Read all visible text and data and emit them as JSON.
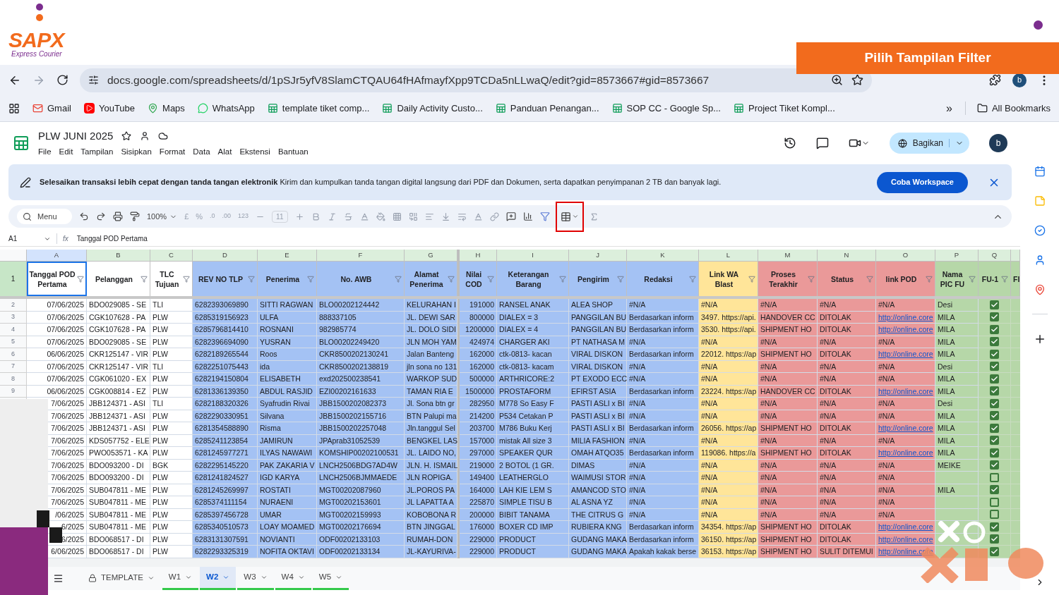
{
  "slide": {
    "logo": {
      "name": "SAPX",
      "tagline": "Express Courier"
    },
    "callout": "Pilih Tampilan Filter"
  },
  "browser": {
    "url": "docs.google.com/spreadsheets/d/1pSJr5yfV8SlamCTQAU64fHAfmayfXpp9TCDa5nLLwaQ/edit?gid=8573667#gid=8573667",
    "profile": "b",
    "bookmarks": [
      {
        "label": "Gmail",
        "kind": "mail"
      },
      {
        "label": "YouTube",
        "kind": "video"
      },
      {
        "label": "Maps",
        "kind": "map"
      },
      {
        "label": "WhatsApp",
        "kind": "chat"
      },
      {
        "label": "template tiket comp...",
        "kind": "sheet"
      },
      {
        "label": "Daily Activity Custo...",
        "kind": "sheet"
      },
      {
        "label": "Panduan Penangan...",
        "kind": "sheet"
      },
      {
        "label": "SOP CC - Google Sp...",
        "kind": "sheet"
      },
      {
        "label": "Project Tiket Kompl...",
        "kind": "sheet"
      }
    ],
    "more": "»",
    "all_bookmarks": "All Bookmarks"
  },
  "doc": {
    "title": "PLW JUNI 2025",
    "menus": [
      "File",
      "Edit",
      "Tampilan",
      "Sisipkan",
      "Format",
      "Data",
      "Alat",
      "Ekstensi",
      "Bantuan"
    ],
    "share": "Bagikan",
    "avatar": "b"
  },
  "promo": {
    "lead": "Selesaikan transaksi lebih cepat dengan tanda tangan elektronik",
    "text": "Kirim dan kumpulkan tanda tangan digital langsung dari PDF dan Dokumen, serta dapatkan penyimpanan 2 TB dan banyak lagi.",
    "button": "Coba Workspace"
  },
  "toolbar": {
    "search": "Menu",
    "zoom": "100%",
    "currency": "£",
    "percent": "%",
    "dec_less": ".0",
    "dec_more": ".00",
    "number_format": "123",
    "font_size": "11",
    "filter_view_highlighted": true
  },
  "formula_bar": {
    "cell": "A1",
    "fx": "fx",
    "value": "Tanggal POD Pertama"
  },
  "columns": [
    {
      "letter": "A",
      "label": "Tanggal POD Pertama",
      "color": "#ffffff"
    },
    {
      "letter": "B",
      "label": "Pelanggan",
      "color": "#ffffff"
    },
    {
      "letter": "C",
      "label": "TLC Tujuan",
      "color": "#ffffff"
    },
    {
      "letter": "D",
      "label": "REV NO TLP",
      "color": "#a4c2f4"
    },
    {
      "letter": "E",
      "label": "Penerima",
      "color": "#a4c2f4"
    },
    {
      "letter": "F",
      "label": "No. AWB",
      "color": "#a4c2f4"
    },
    {
      "letter": "G",
      "label": "Alamat Penerima",
      "color": "#a4c2f4"
    },
    {
      "letter": "H",
      "label": "Nilai COD",
      "color": "#a4c2f4"
    },
    {
      "letter": "I",
      "label": "Keterangan Barang",
      "color": "#a4c2f4"
    },
    {
      "letter": "J",
      "label": "Pengirim",
      "color": "#a4c2f4"
    },
    {
      "letter": "K",
      "label": "Redaksi",
      "color": "#a4c2f4"
    },
    {
      "letter": "L",
      "label": "Link WA Blast",
      "color": "#ffe599"
    },
    {
      "letter": "M",
      "label": "Proses Terakhir",
      "color": "#ea9999"
    },
    {
      "letter": "N",
      "label": "Status",
      "color": "#ea9999"
    },
    {
      "letter": "O",
      "label": "link POD",
      "color": "#ea9999"
    },
    {
      "letter": "P",
      "label": "Nama PIC FU",
      "color": "#b6d7a8"
    },
    {
      "letter": "Q",
      "label": "FU-1",
      "color": "#b6d7a8"
    },
    {
      "label": "FI",
      "color": "#b6d7a8"
    }
  ],
  "header_row_number": "1",
  "rows": [
    {
      "num": "2",
      "cells": [
        "07/06/2025",
        "BDO029085 - SE",
        "TLI",
        "6282393069890",
        "SITTI RAGWAN",
        "BLO00202124442",
        "KELURAHAN I",
        "191000",
        "RANSEL ANAK",
        "ALEA SHOP",
        "#N/A",
        "#N/A",
        "#N/A",
        "#N/A",
        "#N/A",
        "Desi"
      ],
      "pod_linked": false,
      "fu1": true
    },
    {
      "num": "3",
      "cells": [
        "07/06/2025",
        "CGK107628 - PA",
        "PLW",
        "6285319156923",
        "ULFA",
        "888337105",
        "JL. DEWI SAR",
        "800000",
        "DIALEX = 3",
        "PANGGILAN BU",
        "Berdasarkan inform",
        "3497. https://api.",
        "HANDOVER CC",
        "DITOLAK",
        "http://online.core",
        "MILA"
      ],
      "pod_linked": true,
      "fu1": true
    },
    {
      "num": "4",
      "cells": [
        "07/06/2025",
        "CGK107628 - PA",
        "PLW",
        "6285796814410",
        "ROSNANI",
        "982985774",
        "JL. DOLO SIDI",
        "1200000",
        "DIALEX = 4",
        "PANGGILAN BU",
        "Berdasarkan inform",
        "3530. https://api.",
        "SHIPMENT HO",
        "DITOLAK",
        "http://online.core",
        "MILA"
      ],
      "pod_linked": true,
      "fu1": true
    },
    {
      "num": "5",
      "cells": [
        "07/06/2025",
        "BDO029085 - SE",
        "PLW",
        "6282396694090",
        "YUSRAN",
        "BLO00202249420",
        "JLN MOH YAM",
        "424974",
        "CHARGER AKI",
        "PT NATHASA M",
        "#N/A",
        "#N/A",
        "#N/A",
        "#N/A",
        "#N/A",
        "MILA"
      ],
      "pod_linked": false,
      "fu1": true
    },
    {
      "num": "6",
      "cells": [
        "06/06/2025",
        "CKR125147 - VIR",
        "PLW",
        "6282189265544",
        "Roos",
        "CKR8500202130241",
        "Jalan Banteng",
        "162000",
        "ctk-0813-  kacan",
        "VIRAL DISKON",
        "Berdasarkan inform",
        "22012. https://ap",
        "SHIPMENT HO",
        "DITOLAK",
        "http://online.core",
        "MILA"
      ],
      "pod_linked": true,
      "fu1": true
    },
    {
      "num": "7",
      "cells": [
        "07/06/2025",
        "CKR125147 - VIR",
        "TLI",
        "6282251075443",
        "ida",
        "CKR8500202138819",
        "jln sona no 131",
        "162000",
        "ctk-0813- kacam",
        "VIRAL DISKON",
        "#N/A",
        "#N/A",
        "#N/A",
        "#N/A",
        "#N/A",
        "Desi"
      ],
      "pod_linked": false,
      "fu1": true
    },
    {
      "num": "8",
      "cells": [
        "07/06/2025",
        "CGK061020 - EX",
        "PLW",
        "6282194150804",
        "ELISABETH",
        "exd202500238541",
        "WARKOP SUD",
        "500000",
        "ARTHRICORE:2",
        "PT EXODO ECC",
        "#N/A",
        "#N/A",
        "#N/A",
        "#N/A",
        "#N/A",
        "MILA"
      ],
      "pod_linked": false,
      "fu1": true
    },
    {
      "num": "9",
      "cells": [
        "06/06/2025",
        "CGK008814 - EZ",
        "PLW",
        "6281336139350",
        "ABDUL RASJID",
        "EZI00202161633",
        "TAMAN RIA E",
        "1500000",
        "PROSTAFORM",
        "EFIRST ASIA",
        "Berdasarkan inform",
        "23224. https://ap",
        "HANDOVER CC",
        "DITOLAK",
        "http://online.core",
        "MILA"
      ],
      "pod_linked": true,
      "fu1": true
    },
    {
      "cells": [
        "7/06/2025",
        "JBB124371 - ASI",
        "TLI",
        "6282188320326",
        "Syafrudin Rivai",
        "JBB1500202082373",
        "Jl. Sona btn gr",
        "282950",
        "M778 So Easy F",
        "PASTI ASLI x BI",
        "#N/A",
        "#N/A",
        "#N/A",
        "#N/A",
        "#N/A",
        "Desi"
      ],
      "pod_linked": false,
      "fu1": true
    },
    {
      "cells": [
        "7/06/2025",
        "JBB124371 - ASI",
        "PLW",
        "6282290330951",
        "Silvana",
        "JBB1500202155716",
        "BTN Palupi ma",
        "214200",
        "P534 Cetakan P",
        "PASTI ASLI x BI",
        "#N/A",
        "#N/A",
        "#N/A",
        "#N/A",
        "#N/A",
        "MILA"
      ],
      "pod_linked": false,
      "fu1": true
    },
    {
      "cells": [
        "7/06/2025",
        "JBB124371 - ASI",
        "PLW",
        "6281354588890",
        "Risma",
        "JBB1500202257048",
        "Jln.tanggul Sel",
        "203700",
        "M786 Buku Kerj",
        "PASTI ASLI x BI",
        "Berdasarkan inform",
        "26056. https://ap",
        "SHIPMENT HO",
        "DITOLAK",
        "http://online.core",
        "MILA"
      ],
      "pod_linked": true,
      "fu1": true
    },
    {
      "cells": [
        "7/06/2025",
        "KDS057752 - ELE",
        "PLW",
        "6285241123854",
        "JAMIRUN",
        "JPAprab31052539",
        "BENGKEL LAS",
        "157000",
        "mistak All size 3",
        "MILIA FASHION",
        "#N/A",
        "#N/A",
        "#N/A",
        "#N/A",
        "#N/A",
        "MILA"
      ],
      "pod_linked": false,
      "fu1": true
    },
    {
      "cells": [
        "7/06/2025",
        "PWO053571 - KA",
        "PLW",
        "6281245977271",
        "ILYAS NAWAWI",
        "KOMSHIP00202100531",
        "JL. LAIDO NO,",
        "297000",
        "SPEAKER QUR",
        "OMAH ATQO35",
        "Berdasarkan inform",
        "119086. https://a",
        "SHIPMENT HO",
        "DITOLAK",
        "http://online.core",
        "MILA"
      ],
      "pod_linked": true,
      "fu1": true
    },
    {
      "cells": [
        "7/06/2025",
        "BDO093200 - DI",
        "BGK",
        "6282295145220",
        "PAK ZAKARIA V",
        "LNCH2506BDG7AD4W",
        "JLN. H. ISMAIL",
        "219000",
        "2 BOTOL (1 GR.",
        "DIMAS",
        "#N/A",
        "#N/A",
        "#N/A",
        "#N/A",
        "#N/A",
        "MEIKE"
      ],
      "pod_linked": false,
      "fu1": true
    },
    {
      "cells": [
        "7/06/2025",
        "BDO093200 - DI",
        "PLW",
        "6281241824527",
        "IGD KARYA",
        "LNCH2506BJMMAEDE",
        "JLN ROPIGA.",
        "149400",
        "LEATHERGLO",
        "WAIMUSI STOR",
        "#N/A",
        "#N/A",
        "#N/A",
        "#N/A",
        "#N/A",
        ""
      ],
      "pod_linked": false,
      "fu1": false
    },
    {
      "cells": [
        "7/06/2025",
        "SUB047811 - ME",
        "PLW",
        "6281245269997",
        "ROSTATI",
        "MGT00202087960",
        "JL.POROS PA",
        "164000",
        "LAH KIE LEM S",
        "AMANCOD STO",
        "#N/A",
        "#N/A",
        "#N/A",
        "#N/A",
        "#N/A",
        "MILA"
      ],
      "pod_linked": false,
      "fu1": true
    },
    {
      "cells": [
        "7/06/2025",
        "SUB047811 - ME",
        "PLW",
        "6285374111154",
        "NURAENI",
        "MGT00202153601",
        "JL LAPATTA A",
        "225870",
        "SIMPLE TISU B",
        "AL ASNA YZ",
        "#N/A",
        "#N/A",
        "#N/A",
        "#N/A",
        "#N/A",
        ""
      ],
      "pod_linked": false,
      "fu1": false
    },
    {
      "cells": [
        "/06/2025",
        "SUB047811 - ME",
        "PLW",
        "6285397456728",
        "UMAR",
        "MGT00202159993",
        "KOBOBONA R",
        "200000",
        "BIBIT TANAMA",
        "THE CITRUS G",
        "#N/A",
        "#N/A",
        "#N/A",
        "#N/A",
        "#N/A",
        ""
      ],
      "pod_linked": false,
      "fu1": false
    },
    {
      "cells": [
        "6/2025",
        "SUB047811 - ME",
        "PLW",
        "6285340510573",
        "LOAY MOAMED",
        "MGT00202176694",
        "BTN JINGGAL",
        "176000",
        "BOXER CD IMP",
        "RUBIERA KNG",
        "Berdasarkan inform",
        "34354. https://ap",
        "SHIPMENT HO",
        "DITOLAK",
        "http://online.core",
        ""
      ],
      "pod_linked": true,
      "fu1": true
    },
    {
      "cells": [
        "6/2025",
        "BDO068517 - DI",
        "PLW",
        "6283131307591",
        "NOVIANTI",
        "ODF00202133103",
        "RUMAH-DON",
        "229000",
        "PRODUCT",
        "GUDANG MAKA",
        "Berdasarkan inform",
        "36150. https://ap",
        "SHIPMENT HO",
        "DITOLAK",
        "http://online.core",
        ""
      ],
      "pod_linked": true,
      "fu1": true
    },
    {
      "cells": [
        "6/06/2025",
        "BDO068517 - DI",
        "PLW",
        "6282293325319",
        "NOFITA OKTAVI",
        "ODF00202133134",
        "JL-KAYURIVA-",
        "229000",
        "PRODUCT",
        "GUDANG MAKA",
        "Apakah kakak berse",
        "36153. https://ap",
        "SHIPMENT HO",
        "SULIT DITEMUI",
        "http://online.core",
        ""
      ],
      "pod_linked": true,
      "fu1": true
    }
  ],
  "sheet_tabs": [
    {
      "label": "TEMPLATE",
      "locked": true,
      "selected": false
    },
    {
      "label": "W1",
      "locked": false,
      "selected": false
    },
    {
      "label": "W2",
      "locked": false,
      "selected": true
    },
    {
      "label": "W3",
      "locked": false,
      "selected": false
    },
    {
      "label": "W4",
      "locked": false,
      "selected": false
    },
    {
      "label": "W5",
      "locked": false,
      "selected": false
    }
  ]
}
